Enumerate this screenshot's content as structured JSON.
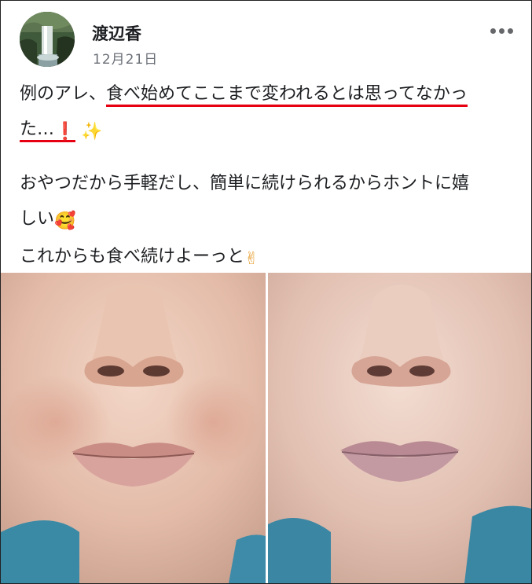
{
  "post": {
    "author": "渡辺香",
    "timestamp": "12月21日",
    "more_icon": "more-horizontal-icon",
    "lines": {
      "l1_a": "例のアレ、",
      "l1_b": "食べ始めてここまで変われるとは思ってなかっ",
      "l2_a": "た…",
      "l3": "おやつだから手軽だし、簡単に続けられるからホントに嬉",
      "l4": "しい",
      "l5": "これからも食べ続けよーっと"
    },
    "emoji": {
      "exclamation": "❗",
      "sparkles": "✨",
      "smiling_hearts": "🥰",
      "victory": "✌"
    },
    "photo": {
      "description_icon": "before-after-face-photo",
      "left_panel": "before",
      "right_panel": "after"
    }
  },
  "colors": {
    "underline": "#e60012",
    "author_text": "#1c1e21",
    "timestamp_text": "#6a6f77"
  }
}
